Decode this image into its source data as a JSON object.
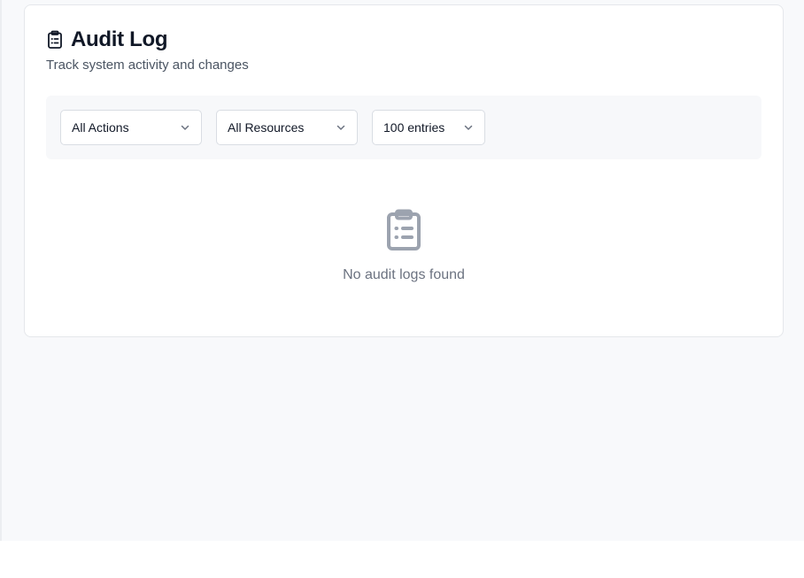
{
  "page": {
    "title": "Audit Log",
    "subtitle": "Track system activity and changes",
    "header_icon": "clipboard-list-icon"
  },
  "filters": {
    "actions": {
      "selected": "All Actions"
    },
    "resources": {
      "selected": "All Resources"
    },
    "entries": {
      "selected": "100 entries"
    }
  },
  "empty_state": {
    "icon": "clipboard-list-icon",
    "message": "No audit logs found"
  },
  "colors": {
    "page_background": "#f8f9fb",
    "card_background": "#ffffff",
    "filter_bar_background": "#f7f8fa",
    "empty_icon": "#9ca3af",
    "text_primary": "#111827",
    "text_muted": "#6b7280"
  }
}
